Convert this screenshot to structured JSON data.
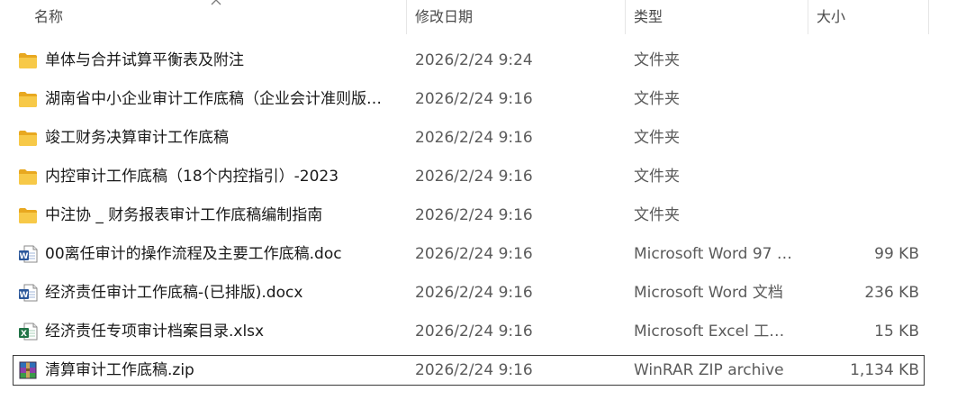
{
  "columns": {
    "name": "名称",
    "modified": "修改日期",
    "type": "类型",
    "size": "大小"
  },
  "colors": {
    "folder": "#f5c242",
    "word": "#2b579a",
    "excel": "#217346",
    "winrar": "#7a3e9d",
    "focus_border": "#3a3a3a"
  },
  "files": [
    {
      "name": "单体与合并试算平衡表及附注",
      "modified": "2026/2/24 9:24",
      "type": "文件夹",
      "size": "",
      "icon": "folder-icon"
    },
    {
      "name": "湖南省中小企业审计工作底稿（企业会计准则版…",
      "modified": "2026/2/24 9:16",
      "type": "文件夹",
      "size": "",
      "icon": "folder-icon"
    },
    {
      "name": "竣工财务决算审计工作底稿",
      "modified": "2026/2/24 9:16",
      "type": "文件夹",
      "size": "",
      "icon": "folder-icon"
    },
    {
      "name": "内控审计工作底稿（18个内控指引）-2023",
      "modified": "2026/2/24 9:16",
      "type": "文件夹",
      "size": "",
      "icon": "folder-icon"
    },
    {
      "name": "中注协 _ 财务报表审计工作底稿编制指南",
      "modified": "2026/2/24 9:16",
      "type": "文件夹",
      "size": "",
      "icon": "folder-icon"
    },
    {
      "name": "00离任审计的操作流程及主要工作底稿.doc",
      "modified": "2026/2/24 9:16",
      "type": "Microsoft Word 97 …",
      "size": "99 KB",
      "icon": "word-doc-icon"
    },
    {
      "name": "经济责任审计工作底稿-(已排版).docx",
      "modified": "2026/2/24 9:16",
      "type": "Microsoft Word 文档",
      "size": "236 KB",
      "icon": "word-doc-icon"
    },
    {
      "name": "经济责任专项审计档案目录.xlsx",
      "modified": "2026/2/24 9:16",
      "type": "Microsoft Excel 工…",
      "size": "15 KB",
      "icon": "excel-sheet-icon"
    },
    {
      "name": "清算审计工作底稿.zip",
      "modified": "2026/2/24 9:16",
      "type": "WinRAR ZIP archive",
      "size": "1,134 KB",
      "icon": "winrar-archive-icon"
    }
  ]
}
